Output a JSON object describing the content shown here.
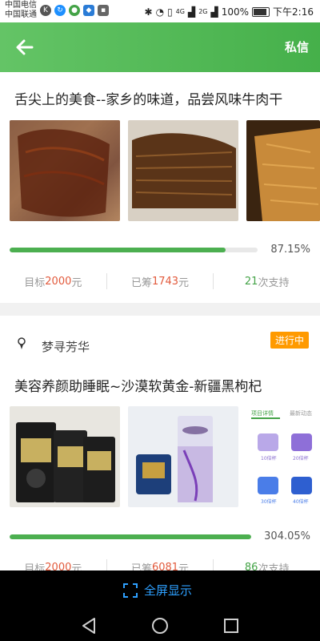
{
  "status": {
    "carrier1": "中国电信",
    "carrier2": "中国联通",
    "net1": "4G",
    "net2": "2G",
    "battery": "100%",
    "time": "下午2:16"
  },
  "appbar": {
    "action_label": "私信"
  },
  "card1": {
    "title": "舌尖上的美食--家乡的味道，品尝风味牛肉干",
    "progress_percent": 87.15,
    "percent_text": "87.15%",
    "goal_label": "目标",
    "goal_value": "2000",
    "raised_label": "已筹",
    "raised_value": "1743",
    "unit": "元",
    "support_count": "21",
    "support_label": "次支持"
  },
  "card2": {
    "username": "梦寻芳华",
    "status_badge": "进行中",
    "title": "美容养颜助睡眠~沙漠软黄金-新疆黑枸杞",
    "progress_percent": 100,
    "percent_text": "304.05%",
    "goal_label": "目标",
    "goal_value": "2000",
    "raised_label": "已筹",
    "raised_value": "6081",
    "unit": "元",
    "support_count": "86",
    "support_label": "次支持",
    "img3_tab1": "项目详情",
    "img3_tab2": "最新动态",
    "img3_cup1": "10倍杯",
    "img3_cup2": "20倍杯",
    "img3_cup3": "30倍杯",
    "img3_cup4": "40倍杯"
  },
  "bottom": {
    "fullscreen_label": "全屏显示"
  },
  "colors": {
    "primary_green": "#4caf50",
    "accent_red": "#e25a3c",
    "badge_orange": "#ff9a00",
    "link_blue": "#2ea0ff"
  }
}
